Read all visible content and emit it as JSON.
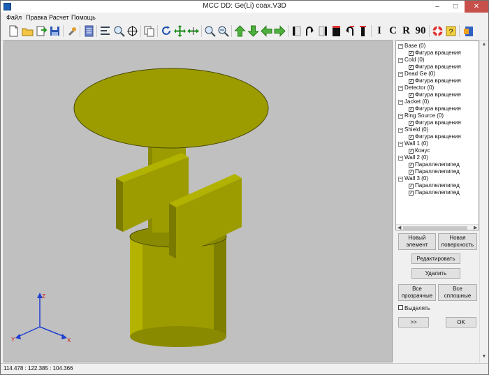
{
  "window": {
    "title": "MCC DD: Ge(Li) coax.V3D",
    "min": "–",
    "max": "□",
    "close": "✕"
  },
  "menu": [
    "Файл",
    "Правка",
    "Расчет",
    "Помощь"
  ],
  "toolbar": {
    "text_buttons": [
      "I",
      "C",
      "R",
      "90"
    ]
  },
  "tree": {
    "items": [
      {
        "label": "Base (0)",
        "children": [
          "Фигура вращения"
        ]
      },
      {
        "label": "Cold (0)",
        "children": [
          "Фигура вращения"
        ]
      },
      {
        "label": "Dead Ge (0)",
        "children": [
          "Фигура вращения"
        ]
      },
      {
        "label": "Detector (0)",
        "children": [
          "Фигура вращения"
        ]
      },
      {
        "label": "Jacket (0)",
        "children": [
          "Фигура вращения"
        ]
      },
      {
        "label": "Ring Source (0)",
        "children": [
          "Фигура вращения"
        ]
      },
      {
        "label": "Shield (0)",
        "children": [
          "Фигура вращения"
        ]
      },
      {
        "label": "Wall 1 (0)",
        "children": [
          "Конус"
        ]
      },
      {
        "label": "Wall 2 (0)",
        "children": [
          "Параллелепипед",
          "Параллелепипед"
        ]
      },
      {
        "label": "Wall 3 (0)",
        "children": [
          "Параллелепипед",
          "Параллелепипед"
        ]
      }
    ]
  },
  "buttons": {
    "new_element": "Новый элемент",
    "new_surface": "Новая поверхность",
    "edit": "Редактировать",
    "delete": "Удалить",
    "all_transparent": "Все прозрачные",
    "all_solid": "Все сплошные",
    "highlight_label": "Выделять",
    "next": ">>",
    "ok": "OK"
  },
  "axes": {
    "x": "X",
    "y": "Y",
    "z": "Z"
  },
  "status": "114.478 : 122.385 : 104.366",
  "colors": {
    "solid": "#9c9c00",
    "solid_dark": "#6e6e00",
    "solid_light": "#b2b200",
    "background": "#c0c0c0"
  }
}
